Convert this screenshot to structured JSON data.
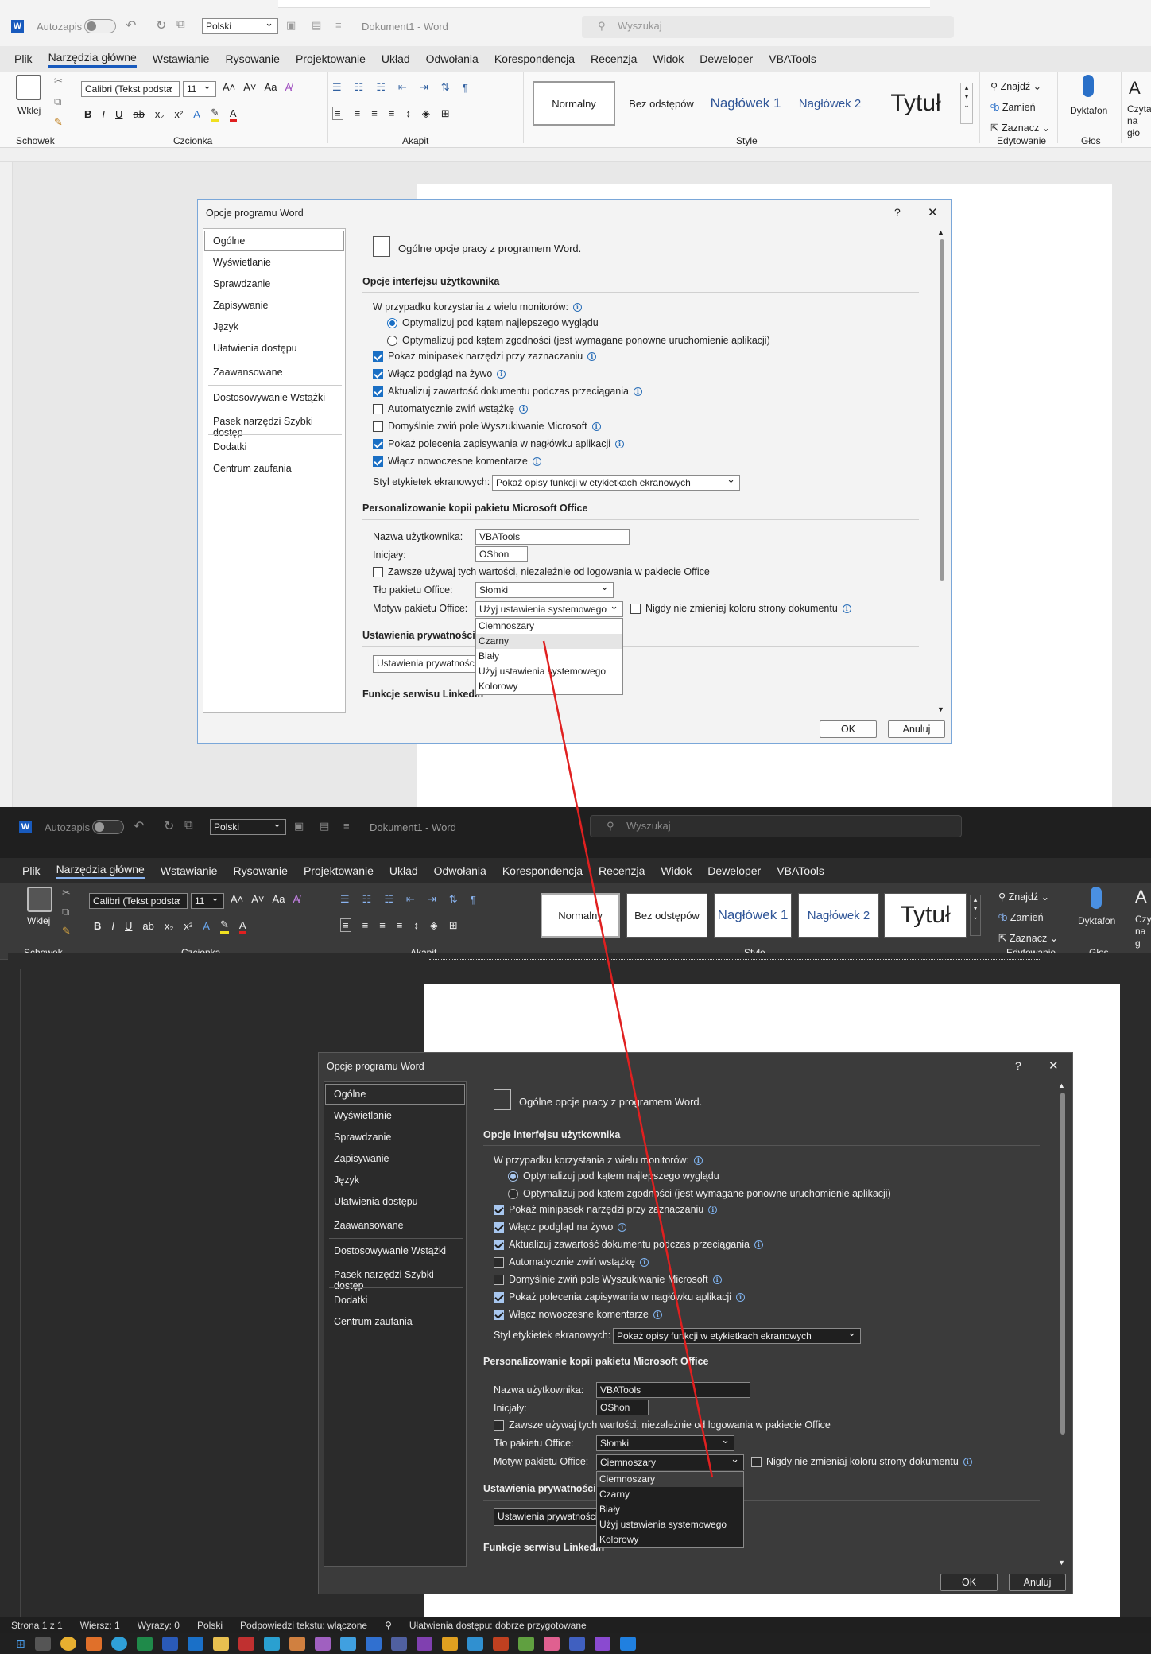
{
  "app": {
    "autosave_label": "Autozapis",
    "language": "Polski",
    "document_title": "Dokument1  -  Word",
    "search_placeholder": "Wyszukaj"
  },
  "menu": [
    "Plik",
    "Narzędzia główne",
    "Wstawianie",
    "Rysowanie",
    "Projektowanie",
    "Układ",
    "Odwołania",
    "Korespondencja",
    "Recenzja",
    "Widok",
    "Deweloper",
    "VBATools"
  ],
  "ribbon": {
    "paste": "Wklej",
    "font_name": "Calibri (Tekst podsta",
    "font_size": "11",
    "groups": {
      "clipboard": "Schowek",
      "font": "Czcionka",
      "paragraph": "Akapit",
      "style": "Style",
      "editing": "Edytowanie",
      "voice": "Głos"
    },
    "styles": [
      "Normalny",
      "Bez odstępów",
      "Nagłówek 1",
      "Nagłówek 2",
      "Tytuł"
    ],
    "find": "Znajdź",
    "replace": "Zamień",
    "select": "Zaznacz",
    "dictate": "Dyktafon",
    "read_aloud_light": "Czyta na gło",
    "read_aloud_dark": "Czy na g"
  },
  "dialog": {
    "title": "Opcje programu Word",
    "help": "?",
    "close": "✕",
    "nav": [
      "Ogólne",
      "Wyświetlanie",
      "Sprawdzanie",
      "Zapisywanie",
      "Język",
      "Ułatwienia dostępu",
      "Zaawansowane",
      "Dostosowywanie Wstążki",
      "Pasek narzędzi Szybki dostęp",
      "Dodatki",
      "Centrum zaufania"
    ],
    "header": "Ogólne opcje pracy z programem Word.",
    "section_ui": "Opcje interfejsu użytkownika",
    "multi_monitor": "W przypadku korzystania z wielu monitorów:",
    "radio_best": "Optymalizuj pod kątem najlepszego wyglądu",
    "radio_compat": "Optymalizuj pod kątem zgodności (jest wymagane ponowne uruchomienie aplikacji)",
    "checks": [
      {
        "label": "Pokaż minipasek narzędzi przy zaznaczaniu",
        "checked": true
      },
      {
        "label": "Włącz podgląd na żywo",
        "checked": true
      },
      {
        "label": "Aktualizuj zawartość dokumentu podczas przeciągania",
        "checked": true
      },
      {
        "label": "Automatycznie zwiń wstążkę",
        "checked": false
      },
      {
        "label": "Domyślnie zwiń pole Wyszukiwanie Microsoft",
        "checked": false
      },
      {
        "label": "Pokaż polecenia zapisywania w nagłówku aplikacji",
        "checked": true
      },
      {
        "label": "Włącz nowoczesne komentarze",
        "checked": true
      }
    ],
    "tooltip_style_label": "Styl etykietek ekranowych:",
    "tooltip_style_value": "Pokaż opisy funkcji w etykietkach ekranowych",
    "section_personal": "Personalizowanie kopii pakietu Microsoft Office",
    "username_label": "Nazwa użytkownika:",
    "username_value": "VBATools",
    "initials_label": "Inicjały:",
    "initials_value": "OShon",
    "always_use": "Zawsze używaj tych wartości, niezależnie od logowania w pakiecie Office",
    "background_label": "Tło pakietu Office:",
    "background_value": "Słomki",
    "theme_label": "Motyw pakietu Office:",
    "theme_value_light": "Użyj ustawienia systemowego",
    "theme_value_dark": "Ciemnoszary",
    "never_change": "Nigdy nie zmieniaj koloru strony dokumentu",
    "theme_options": [
      "Ciemnoszary",
      "Czarny",
      "Biały",
      "Użyj ustawienia systemowego",
      "Kolorowy"
    ],
    "section_privacy": "Ustawienia prywatności",
    "privacy_button": "Ustawienia prywatności",
    "section_linkedin": "Funkcje serwisu LinkedIn",
    "ok": "OK",
    "cancel": "Anuluj"
  },
  "status": {
    "page": "Strona 1 z 1",
    "lines": "Wiersz: 1",
    "words": "Wyrazy: 0",
    "lang": "Polski",
    "predictions": "Podpowiedzi tekstu: włączone",
    "accessibility": "Ułatwienia dostępu: dobrze przygotowane"
  },
  "colors": {
    "accent_blue": "#1a6fc4",
    "arrow_red": "#e02020",
    "dark_bg": "#2b2b2b"
  }
}
